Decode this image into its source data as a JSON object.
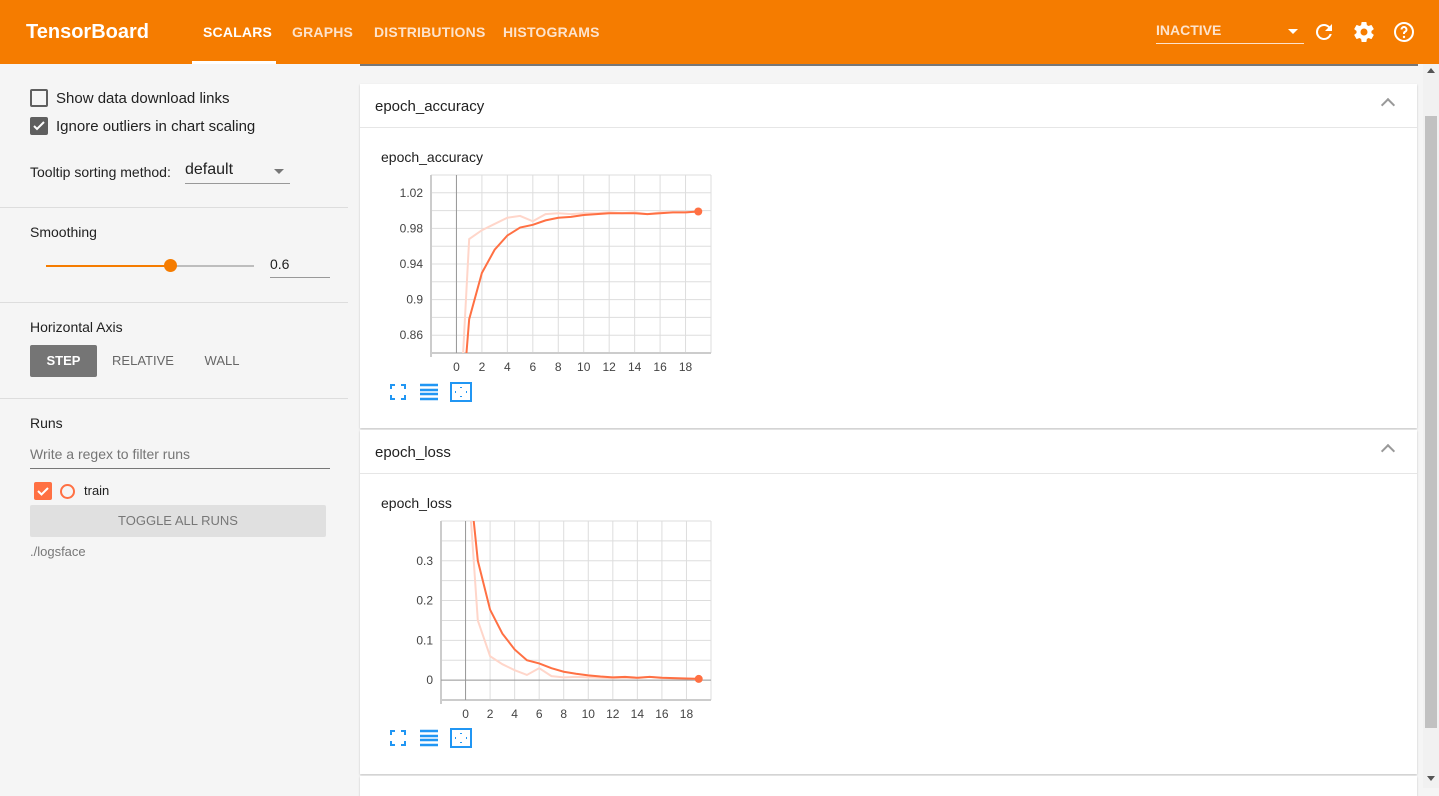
{
  "header": {
    "brand": "TensorBoard",
    "tabs": [
      "SCALARS",
      "GRAPHS",
      "DISTRIBUTIONS",
      "HISTOGRAMS"
    ],
    "active_tab": "SCALARS",
    "run_select": "INACTIVE",
    "icons": [
      "refresh-icon",
      "settings-icon",
      "help-icon"
    ]
  },
  "sidebar": {
    "show_download": {
      "label": "Show data download links",
      "checked": false
    },
    "ignore_outliers": {
      "label": "Ignore outliers in chart scaling",
      "checked": true
    },
    "tooltip_label": "Tooltip sorting method:",
    "tooltip_value": "default",
    "smoothing_label": "Smoothing",
    "smoothing_value": "0.6",
    "smoothing_fraction": 0.6,
    "horizontal_axis_label": "Horizontal Axis",
    "axis_options": [
      "STEP",
      "RELATIVE",
      "WALL"
    ],
    "axis_selected": "STEP",
    "runs_label": "Runs",
    "runs_filter_placeholder": "Write a regex to filter runs",
    "runs": [
      {
        "name": "train",
        "checked": true,
        "color": "#ff7043"
      }
    ],
    "toggle_all": "TOGGLE ALL RUNS",
    "logdir": "./logsface"
  },
  "cards": [
    {
      "title": "epoch_accuracy"
    },
    {
      "title": "epoch_loss"
    }
  ],
  "colors": {
    "accent": "#f57c00",
    "series": "#ff7043",
    "series_raw": "#ffd6ca",
    "icon_blue": "#2196f3"
  },
  "chart_data": [
    {
      "type": "line",
      "title": "epoch_accuracy",
      "xlim": [
        -2,
        20
      ],
      "ylim": [
        0.84,
        1.04
      ],
      "xticks": [
        0,
        2,
        4,
        6,
        8,
        10,
        12,
        14,
        16,
        18
      ],
      "yticks": [
        0.86,
        0.9,
        0.94,
        0.98,
        1.02
      ],
      "ytick_labels": [
        "0.86",
        "0.9",
        "0.94",
        "0.98",
        "1.02"
      ],
      "grid_x_step": 2,
      "grid_y_step": 0.02,
      "x": [
        0,
        1,
        2,
        3,
        4,
        5,
        6,
        7,
        8,
        9,
        10,
        11,
        12,
        13,
        14,
        15,
        16,
        17,
        18,
        19
      ],
      "series": [
        {
          "name": "train (raw)",
          "values": [
            0.7,
            0.968,
            0.978,
            0.985,
            0.992,
            0.994,
            0.988,
            0.996,
            0.997,
            0.996,
            0.997,
            0.997,
            0.998,
            0.997,
            0.998,
            0.996,
            0.998,
            0.998,
            0.998,
            0.999
          ]
        },
        {
          "name": "train",
          "values": [
            0.7,
            0.878,
            0.93,
            0.956,
            0.972,
            0.981,
            0.984,
            0.989,
            0.992,
            0.993,
            0.995,
            0.996,
            0.997,
            0.997,
            0.997,
            0.996,
            0.997,
            0.998,
            0.998,
            0.999
          ]
        }
      ]
    },
    {
      "type": "line",
      "title": "epoch_loss",
      "xlim": [
        -2,
        20
      ],
      "ylim": [
        -0.05,
        0.4
      ],
      "xticks": [
        0,
        2,
        4,
        6,
        8,
        10,
        12,
        14,
        16,
        18
      ],
      "yticks": [
        0,
        0.1,
        0.2,
        0.3
      ],
      "ytick_labels": [
        "0",
        "0.1",
        "0.2",
        "0.3"
      ],
      "grid_x_step": 2,
      "grid_y_step": 0.05,
      "x": [
        0,
        1,
        2,
        3,
        4,
        5,
        6,
        7,
        8,
        9,
        10,
        11,
        12,
        13,
        14,
        15,
        16,
        17,
        18,
        19
      ],
      "series": [
        {
          "name": "train (raw)",
          "values": [
            0.6,
            0.15,
            0.06,
            0.04,
            0.025,
            0.013,
            0.03,
            0.01,
            0.007,
            0.008,
            0.007,
            0.006,
            0.005,
            0.006,
            0.005,
            0.008,
            0.005,
            0.004,
            0.004,
            0.003
          ]
        },
        {
          "name": "train",
          "values": [
            0.6,
            0.3,
            0.177,
            0.117,
            0.077,
            0.05,
            0.042,
            0.03,
            0.021,
            0.016,
            0.012,
            0.009,
            0.007,
            0.008,
            0.006,
            0.008,
            0.006,
            0.005,
            0.004,
            0.003
          ]
        }
      ]
    }
  ]
}
